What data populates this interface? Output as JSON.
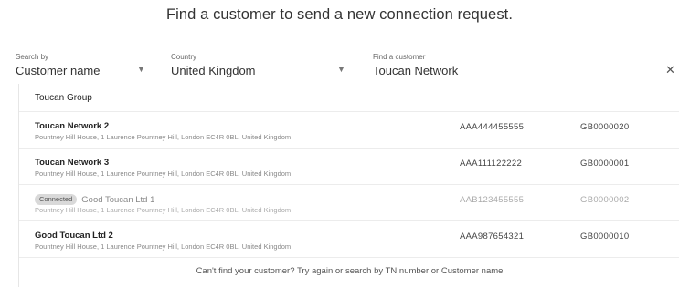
{
  "heading": "Find a customer to send a new connection request.",
  "filters": {
    "search_by": {
      "label": "Search by",
      "value": "Customer name"
    },
    "country": {
      "label": "Country",
      "value": "United Kingdom"
    },
    "find_customer": {
      "label": "Find a customer",
      "value": "Toucan Network"
    }
  },
  "results": {
    "group_label": "Toucan Group",
    "rows": [
      {
        "name": "Toucan Network 2",
        "address": "Pountney Hill House, 1 Laurence Pountney Hill, London EC4R 0BL, United Kingdom",
        "tn": "AAA444455555",
        "gb": "GB0000020"
      },
      {
        "name": "Toucan Network 3",
        "address": "Pountney Hill House, 1 Laurence Pountney Hill, London EC4R 0BL, United Kingdom",
        "tn": "AAA111122222",
        "gb": "GB0000001"
      },
      {
        "badge": "Connected",
        "name": "Good Toucan Ltd 1",
        "address": "Pountney Hill House, 1 Laurence Pountney Hill, London EC4R 0BL, United Kingdom",
        "tn": "AAB123455555",
        "gb": "GB0000002"
      },
      {
        "name": "Good Toucan Ltd 2",
        "address": "Pountney Hill House, 1 Laurence Pountney Hill, London EC4R 0BL, United Kingdom",
        "tn": "AAA987654321",
        "gb": "GB0000010"
      }
    ]
  },
  "footer": "Can't find your customer? Try again or search by TN number or Customer name"
}
